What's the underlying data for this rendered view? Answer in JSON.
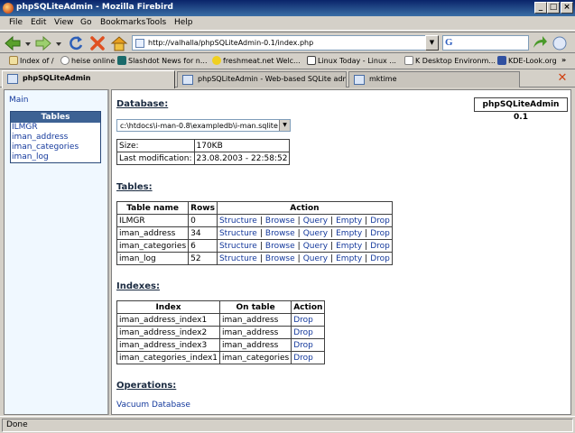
{
  "window": {
    "title": "phpSQLiteAdmin - Mozilla Firebird"
  },
  "menu": [
    "File",
    "Edit",
    "View",
    "Go",
    "Bookmarks",
    "Tools",
    "Help"
  ],
  "nav": {
    "url": "http://valhalla/phpSQLiteAdmin-0.1/index.php",
    "search_value": ""
  },
  "bookmarks": [
    "Index of /",
    "heise online",
    "Slashdot News for n...",
    "freshmeat.net Welc...",
    "Linux Today - Linux ...",
    "K Desktop Environm...",
    "KDE-Look.org"
  ],
  "tabs": [
    {
      "label": "phpSQLiteAdmin"
    },
    {
      "label": "phpSQLiteAdmin - Web-based SQLite admi..."
    },
    {
      "label": "mktime"
    }
  ],
  "sidebar": {
    "main_link": "Main",
    "tables_header": "Tables",
    "tables": [
      "ILMGR",
      "iman_address",
      "iman_categories",
      "iman_log"
    ]
  },
  "main": {
    "badge": "phpSQLiteAdmin 0.1",
    "database_heading": "Database:",
    "database_path": "c:\\htdocs\\i-man-0.8\\exampledb\\i-man.sqlite",
    "info": [
      {
        "label": "Size:",
        "value": "170KB"
      },
      {
        "label": "Last modification:",
        "value": "23.08.2003 - 22:58:52"
      }
    ],
    "tables_heading": "Tables:",
    "tables_headers": [
      "Table name",
      "Rows",
      "Action"
    ],
    "tables_rows": [
      {
        "name": "ILMGR",
        "rows": "0"
      },
      {
        "name": "iman_address",
        "rows": "34"
      },
      {
        "name": "iman_categories",
        "rows": "6"
      },
      {
        "name": "iman_log",
        "rows": "52"
      }
    ],
    "table_actions": [
      "Structure",
      "Browse",
      "Query",
      "Empty",
      "Drop"
    ],
    "action_separator": "|",
    "indexes_heading": "Indexes:",
    "indexes_headers": [
      "Index",
      "On table",
      "Action"
    ],
    "indexes_rows": [
      {
        "index": "iman_address_index1",
        "on_table": "iman_address",
        "action": "Drop"
      },
      {
        "index": "iman_address_index2",
        "on_table": "iman_address",
        "action": "Drop"
      },
      {
        "index": "iman_address_index3",
        "on_table": "iman_address",
        "action": "Drop"
      },
      {
        "index": "iman_categories_index1",
        "on_table": "iman_categories",
        "action": "Drop"
      }
    ],
    "operations_heading": "Operations:",
    "vacuum_link": "Vacuum Database"
  },
  "status": {
    "text": "Done"
  }
}
